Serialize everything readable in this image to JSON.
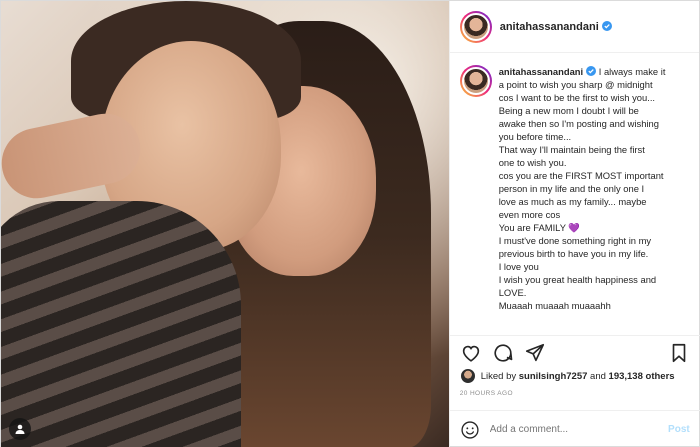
{
  "post": {
    "username": "anitahassanandani",
    "verified": true,
    "caption_lines": [
      "I always make it",
      "a point to wish you sharp @ midnight",
      "cos I want to be the first to wish you...",
      "Being a new mom I doubt I will be",
      "awake then so I'm posting and wishing",
      "you before time...",
      "That way I'll maintain being the first",
      "one to wish you.",
      "cos you are the FIRST MOST important",
      "person in my life and the only one I",
      "love as much as my family... maybe",
      "even more cos",
      "You are FAMILY",
      "I must've done something right in my",
      "previous birth to have you in my life.",
      "I love you",
      "I wish you great health happiness and",
      "LOVE.",
      "Muaaah muaaah muaaahh"
    ],
    "heart_emoji": "💜",
    "likes": {
      "prefix": "Liked by",
      "liker": "sunilsingh7257",
      "middle": "and",
      "count": "193,138 others"
    },
    "timestamp": "20 HOURS AGO",
    "comment_placeholder": "Add a comment...",
    "post_button": "Post"
  },
  "icons": {
    "like": "heart-icon",
    "comment": "comment-icon",
    "share": "share-icon",
    "save": "bookmark-icon",
    "emoji": "smiley-icon",
    "verified": "verified-badge-icon",
    "tagged": "user-tag-icon"
  },
  "colors": {
    "verified": "#3897f0",
    "post_button_disabled": "#b2dffc",
    "heart_emoji": "#8a55c9"
  }
}
